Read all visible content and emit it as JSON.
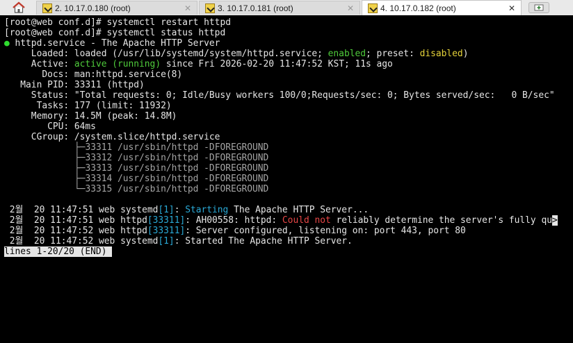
{
  "tabs": [
    {
      "label": "2. 10.17.0.180 (root)",
      "close": "✕"
    },
    {
      "label": "3. 10.17.0.181 (root)",
      "close": "✕"
    },
    {
      "label": "4. 10.17.0.182 (root)",
      "close": "✕"
    }
  ],
  "terminal": {
    "prompt1": "[root@web conf.d]# ",
    "cmd1": "systemctl restart httpd",
    "prompt2": "[root@web conf.d]# ",
    "cmd2": "systemctl status httpd",
    "dot": "●",
    "service_line": " httpd.service - The Apache HTTP Server",
    "loaded_a": "     Loaded: loaded (/usr/lib/systemd/system/httpd.service; ",
    "loaded_enabled": "enabled",
    "loaded_b": "; preset: ",
    "loaded_disabled": "disabled",
    "loaded_c": ")",
    "active_a": "     Active: ",
    "active_state": "active (running)",
    "active_b": " since Fri 2026-02-20 11:47:52 KST; 11s ago",
    "docs": "       Docs: man:httpd.service(8)",
    "mainpid": "   Main PID: 33311 (httpd)",
    "status": "     Status: \"Total requests: 0; Idle/Busy workers 100/0;Requests/sec: 0; Bytes served/sec:   0 B/sec\"",
    "tasks": "      Tasks: 177 (limit: 11932)",
    "memory": "     Memory: 14.5M (peak: 14.8M)",
    "cpu": "        CPU: 64ms",
    "cgroup": "     CGroup: /system.slice/httpd.service",
    "tree_prefix": "             ",
    "cgroup_branches": [
      "├─",
      "├─",
      "├─",
      "├─",
      "└─"
    ],
    "cgroup_procs": [
      "33311 /usr/sbin/httpd -DFOREGROUND",
      "33312 /usr/sbin/httpd -DFOREGROUND",
      "33313 /usr/sbin/httpd -DFOREGROUND",
      "33314 /usr/sbin/httpd -DFOREGROUND",
      "33315 /usr/sbin/httpd -DFOREGROUND"
    ],
    "log1_a": " 2월  20 11:47:51 web systemd",
    "log1_pid": "[1]",
    "log1_b": ": ",
    "log1_msg": "Starting",
    "log1_c": " The Apache HTTP Server...",
    "log2_a": " 2월  20 11:47:51 web httpd",
    "log2_pid": "[33311]",
    "log2_b": ": AH00558: httpd: ",
    "log2_could": "Could not",
    "log2_c": " reliably determine the server's fully qu",
    "log2_more": ">",
    "log3_a": " 2월  20 11:47:52 web httpd",
    "log3_pid": "[33311]",
    "log3_b": ": Server configured, listening on: port 443, port 80",
    "log4_a": " 2월  20 11:47:52 web systemd",
    "log4_pid": "[1]",
    "log4_b": ": Started The Apache HTTP Server.",
    "pager": "lines 1-20/20 (END)"
  },
  "colors": {
    "tabbar": "#e9e9e9",
    "terminal_bg": "#000000",
    "green": "#4fcc3b",
    "cyan": "#2aa9d6",
    "red": "#e84646",
    "yellow": "#e6d33a"
  }
}
